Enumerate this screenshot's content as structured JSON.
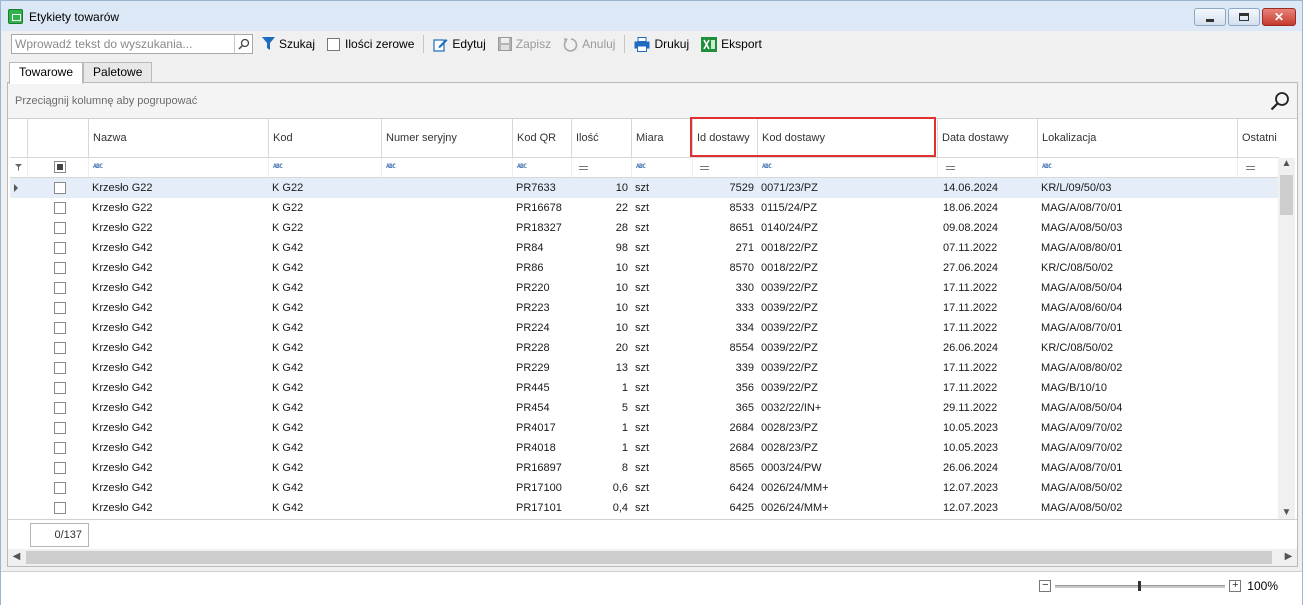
{
  "window": {
    "title": "Etykiety towarów"
  },
  "toolbar": {
    "search_placeholder": "Wprowadź tekst do wyszukania...",
    "find_label": "Szukaj",
    "zero_qty_label": "Ilości zerowe",
    "edit_label": "Edytuj",
    "save_label": "Zapisz",
    "cancel_label": "Anuluj",
    "print_label": "Drukuj",
    "export_label": "Eksport"
  },
  "tabs": [
    "Towarowe",
    "Paletowe"
  ],
  "grid": {
    "group_hint": "Przeciągnij kolumnę aby pogrupować",
    "columns": [
      "Nazwa",
      "Kod",
      "Numer seryjny",
      "Kod QR",
      "Ilość",
      "Miara",
      "Id dostawy",
      "Kod dostawy",
      "Data dostawy",
      "Lokalizacja",
      "Ostatni wy"
    ],
    "filter_abc": "ABC",
    "rows": [
      [
        "Krzesło G22",
        "K G22",
        "",
        "PR7633",
        "10",
        "szt",
        "7529",
        "0071/23/PZ",
        "14.06.2024",
        "KR/L/09/50/03"
      ],
      [
        "Krzesło G22",
        "K G22",
        "",
        "PR16678",
        "22",
        "szt",
        "8533",
        "0115/24/PZ",
        "18.06.2024",
        "MAG/A/08/70/01"
      ],
      [
        "Krzesło G22",
        "K G22",
        "",
        "PR18327",
        "28",
        "szt",
        "8651",
        "0140/24/PZ",
        "09.08.2024",
        "MAG/A/08/50/03"
      ],
      [
        "Krzesło G42",
        "K G42",
        "",
        "PR84",
        "98",
        "szt",
        "271",
        "0018/22/PZ",
        "07.11.2022",
        "MAG/A/08/80/01"
      ],
      [
        "Krzesło G42",
        "K G42",
        "",
        "PR86",
        "10",
        "szt",
        "8570",
        "0018/22/PZ",
        "27.06.2024",
        "KR/C/08/50/02"
      ],
      [
        "Krzesło G42",
        "K G42",
        "",
        "PR220",
        "10",
        "szt",
        "330",
        "0039/22/PZ",
        "17.11.2022",
        "MAG/A/08/50/04"
      ],
      [
        "Krzesło G42",
        "K G42",
        "",
        "PR223",
        "10",
        "szt",
        "333",
        "0039/22/PZ",
        "17.11.2022",
        "MAG/A/08/60/04"
      ],
      [
        "Krzesło G42",
        "K G42",
        "",
        "PR224",
        "10",
        "szt",
        "334",
        "0039/22/PZ",
        "17.11.2022",
        "MAG/A/08/70/01"
      ],
      [
        "Krzesło G42",
        "K G42",
        "",
        "PR228",
        "20",
        "szt",
        "8554",
        "0039/22/PZ",
        "26.06.2024",
        "KR/C/08/50/02"
      ],
      [
        "Krzesło G42",
        "K G42",
        "",
        "PR229",
        "13",
        "szt",
        "339",
        "0039/22/PZ",
        "17.11.2022",
        "MAG/A/08/80/02"
      ],
      [
        "Krzesło G42",
        "K G42",
        "",
        "PR445",
        "1",
        "szt",
        "356",
        "0039/22/PZ",
        "17.11.2022",
        "MAG/B/10/10"
      ],
      [
        "Krzesło G42",
        "K G42",
        "",
        "PR454",
        "5",
        "szt",
        "365",
        "0032/22/IN+",
        "29.11.2022",
        "MAG/A/08/50/04"
      ],
      [
        "Krzesło G42",
        "K G42",
        "",
        "PR4017",
        "1",
        "szt",
        "2684",
        "0028/23/PZ",
        "10.05.2023",
        "MAG/A/09/70/02"
      ],
      [
        "Krzesło G42",
        "K G42",
        "",
        "PR4018",
        "1",
        "szt",
        "2684",
        "0028/23/PZ",
        "10.05.2023",
        "MAG/A/09/70/02"
      ],
      [
        "Krzesło G42",
        "K G42",
        "",
        "PR16897",
        "8",
        "szt",
        "8565",
        "0003/24/PW",
        "26.06.2024",
        "MAG/A/08/70/01"
      ],
      [
        "Krzesło G42",
        "K G42",
        "",
        "PR17100",
        "0,6",
        "szt",
        "6424",
        "0026/24/MM+",
        "12.07.2023",
        "MAG/A/08/50/02"
      ],
      [
        "Krzesło G42",
        "K G42",
        "",
        "PR17101",
        "0,4",
        "szt",
        "6425",
        "0026/24/MM+",
        "12.07.2023",
        "MAG/A/08/50/02"
      ]
    ],
    "selected_count": "0/137"
  },
  "status": {
    "zoom_label": "100%"
  }
}
